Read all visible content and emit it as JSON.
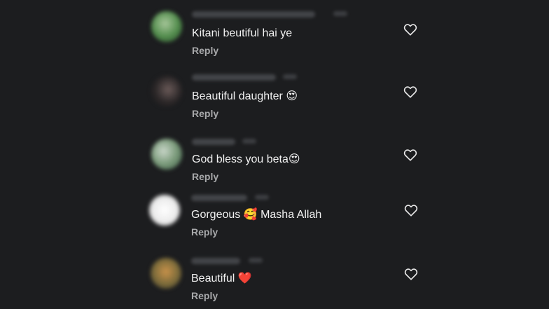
{
  "comments": [
    {
      "text": "Kitani beutiful hai ye",
      "reply_label": "Reply",
      "like_icon": "heart-outline-icon",
      "avatar_colors": [
        "#4f8a4a",
        "#a7c79a",
        "#2f4a30"
      ]
    },
    {
      "text": "Beautiful daughter 😍",
      "reply_label": "Reply",
      "like_icon": "heart-outline-icon",
      "avatar_colors": [
        "#6a5a58",
        "#2a2627",
        "#1d1b1c"
      ]
    },
    {
      "text": "God bless you beta😍",
      "reply_label": "Reply",
      "like_icon": "heart-outline-icon",
      "avatar_colors": [
        "#7a9a7a",
        "#c9d6c9",
        "#3b5a44"
      ]
    },
    {
      "text": "Gorgeous 🥰 Masha Allah",
      "reply_label": "Reply",
      "like_icon": "heart-outline-icon",
      "avatar_colors": [
        "#ffffff",
        "#e9e9e9",
        "#bdbdbd"
      ]
    },
    {
      "text": "Beautiful ❤️",
      "reply_label": "Reply",
      "like_icon": "heart-outline-icon",
      "avatar_colors": [
        "#c9924a",
        "#7a6a3a",
        "#3f3a2a"
      ]
    }
  ]
}
